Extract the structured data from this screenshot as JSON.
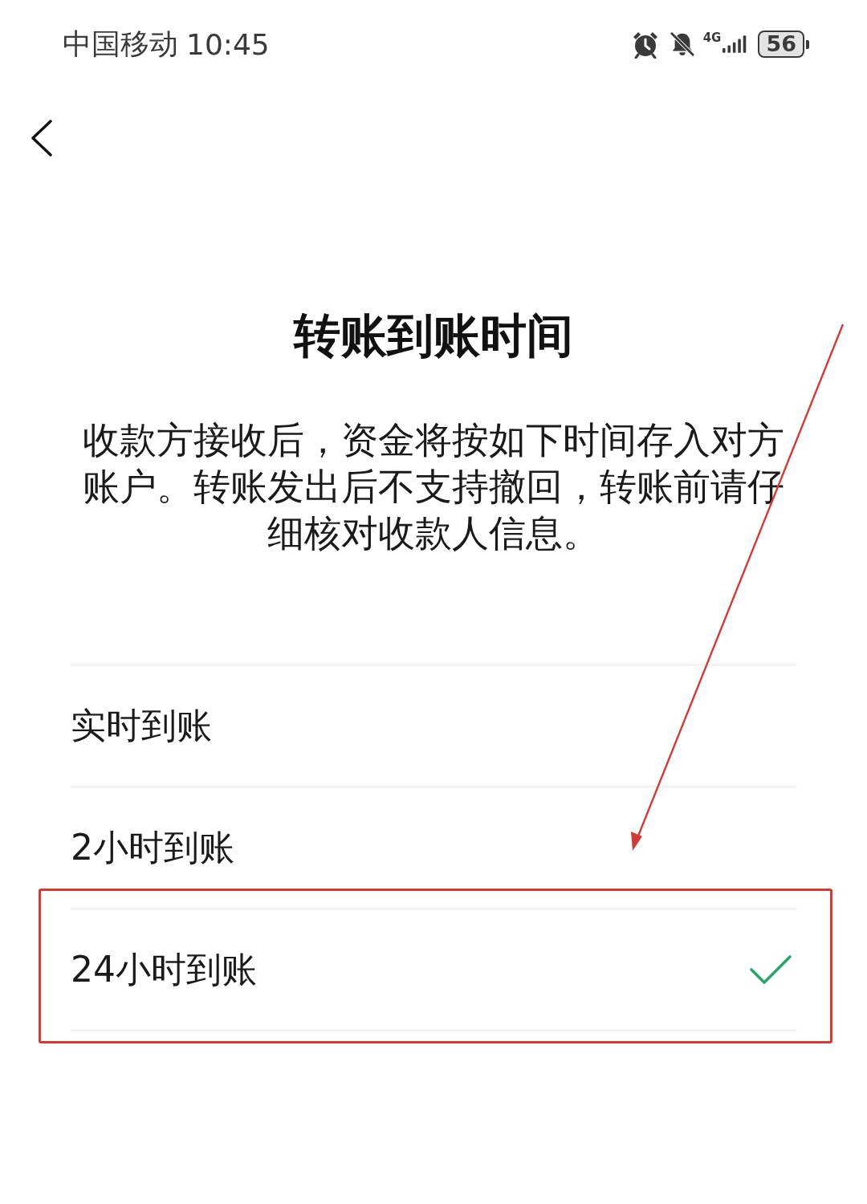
{
  "status_bar": {
    "carrier": "中国移动",
    "time": "10:45",
    "network": "4G",
    "battery": "56"
  },
  "title": "转账到账时间",
  "description": "收款方接收后，资金将按如下时间存入对方账户。转账发出后不支持撤回，转账前请仔细核对收款人信息。",
  "options": [
    {
      "label": "实时到账",
      "selected": false,
      "highlighted": false
    },
    {
      "label": "2小时到账",
      "selected": false,
      "highlighted": false
    },
    {
      "label": "24小时到账",
      "selected": true,
      "highlighted": true
    }
  ],
  "annotation": {
    "arrow": true
  }
}
